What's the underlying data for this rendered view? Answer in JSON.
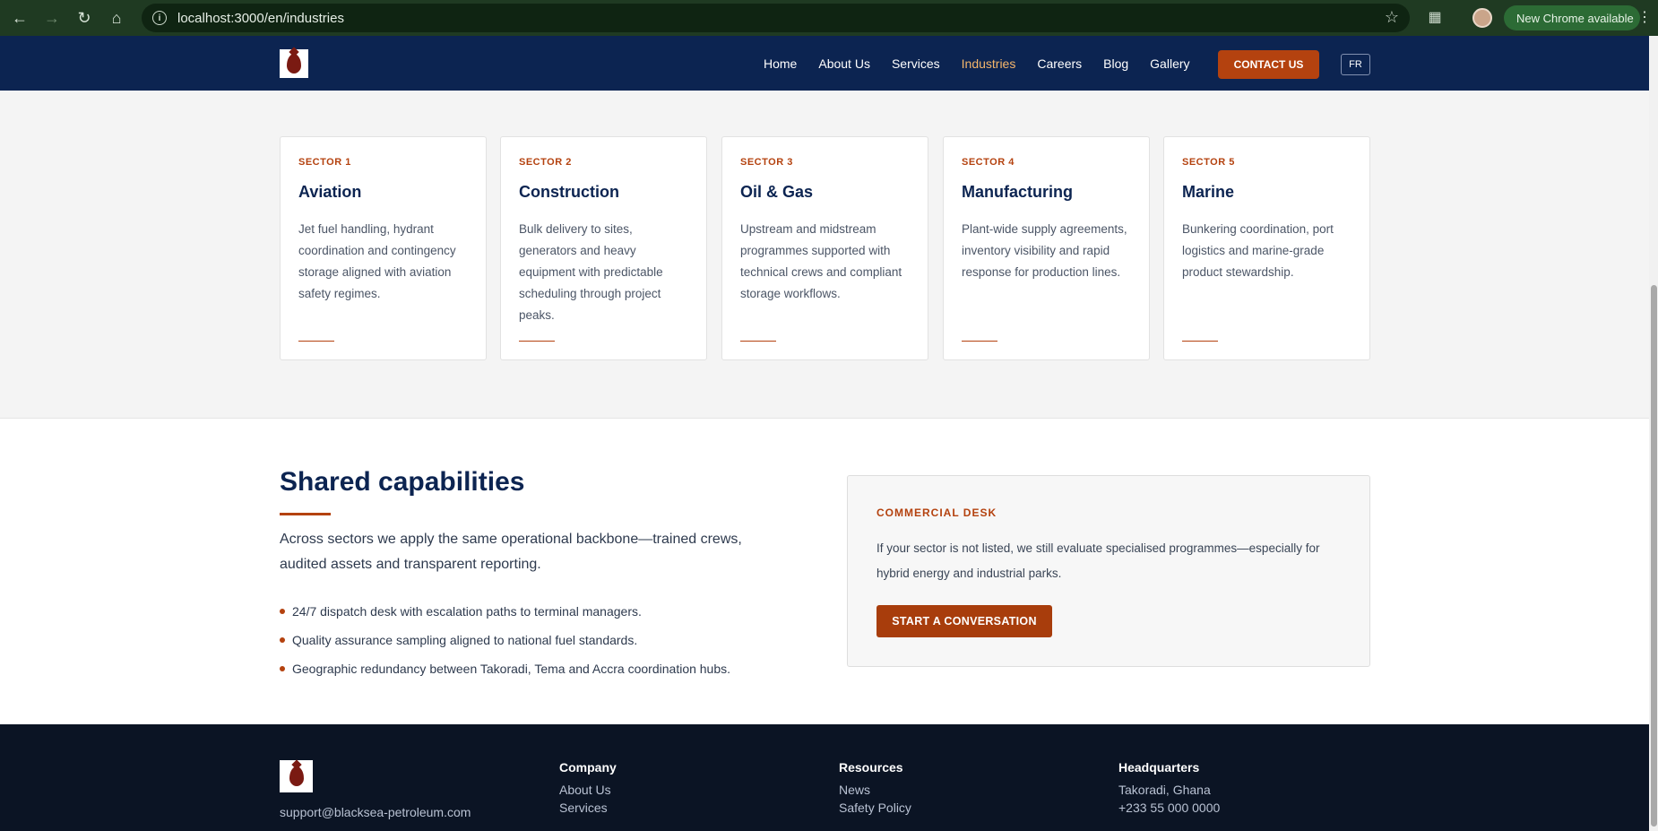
{
  "browser": {
    "url": "localhost:3000/en/industries",
    "update_label": "New Chrome available",
    "colors": {
      "frame": "#1f3a22",
      "omnibox": "#0f2412"
    }
  },
  "header": {
    "nav": [
      {
        "label": "Home",
        "active": false
      },
      {
        "label": "About Us",
        "active": false
      },
      {
        "label": "Services",
        "active": false
      },
      {
        "label": "Industries",
        "active": true
      },
      {
        "label": "Careers",
        "active": false
      },
      {
        "label": "Blog",
        "active": false
      },
      {
        "label": "Gallery",
        "active": false
      }
    ],
    "contact_label": "CONTACT US",
    "lang_label": "FR",
    "colors": {
      "background": "#0c2451",
      "active": "#f5b66b",
      "accent": "#b4420f"
    }
  },
  "sectors": [
    {
      "kicker": "SECTOR 1",
      "title": "Aviation",
      "desc": "Jet fuel handling, hydrant coordination and contingency storage aligned with aviation safety regimes."
    },
    {
      "kicker": "SECTOR 2",
      "title": "Construction",
      "desc": "Bulk delivery to sites, generators and heavy equipment with predictable scheduling through project peaks."
    },
    {
      "kicker": "SECTOR 3",
      "title": "Oil & Gas",
      "desc": "Upstream and midstream programmes supported with technical crews and compliant storage workflows."
    },
    {
      "kicker": "SECTOR 4",
      "title": "Manufacturing",
      "desc": "Plant-wide supply agreements, inventory visibility and rapid response for production lines."
    },
    {
      "kicker": "SECTOR 5",
      "title": "Marine",
      "desc": "Bunkering coordination, port logistics and marine-grade product stewardship."
    }
  ],
  "capabilities": {
    "title": "Shared capabilities",
    "lead": "Across sectors we apply the same operational backbone—trained crews, audited assets and transparent reporting.",
    "items": [
      "24/7 dispatch desk with escalation paths to terminal managers.",
      "Quality assurance sampling aligned to national fuel standards.",
      "Geographic redundancy between Takoradi, Tema and Accra coordination hubs."
    ]
  },
  "desk": {
    "kicker": "COMMERCIAL DESK",
    "text": "If your sector is not listed, we still evaluate specialised programmes—especially for hybrid energy and industrial parks.",
    "cta": "START A CONVERSATION"
  },
  "footer": {
    "email": "support@blacksea-petroleum.com",
    "columns": [
      {
        "heading": "Company",
        "links": [
          "About Us",
          "Services"
        ]
      },
      {
        "heading": "Resources",
        "links": [
          "News",
          "Safety Policy"
        ]
      },
      {
        "heading": "Headquarters",
        "links": [
          "Takoradi, Ghana",
          "+233 55 000 0000"
        ]
      }
    ]
  }
}
